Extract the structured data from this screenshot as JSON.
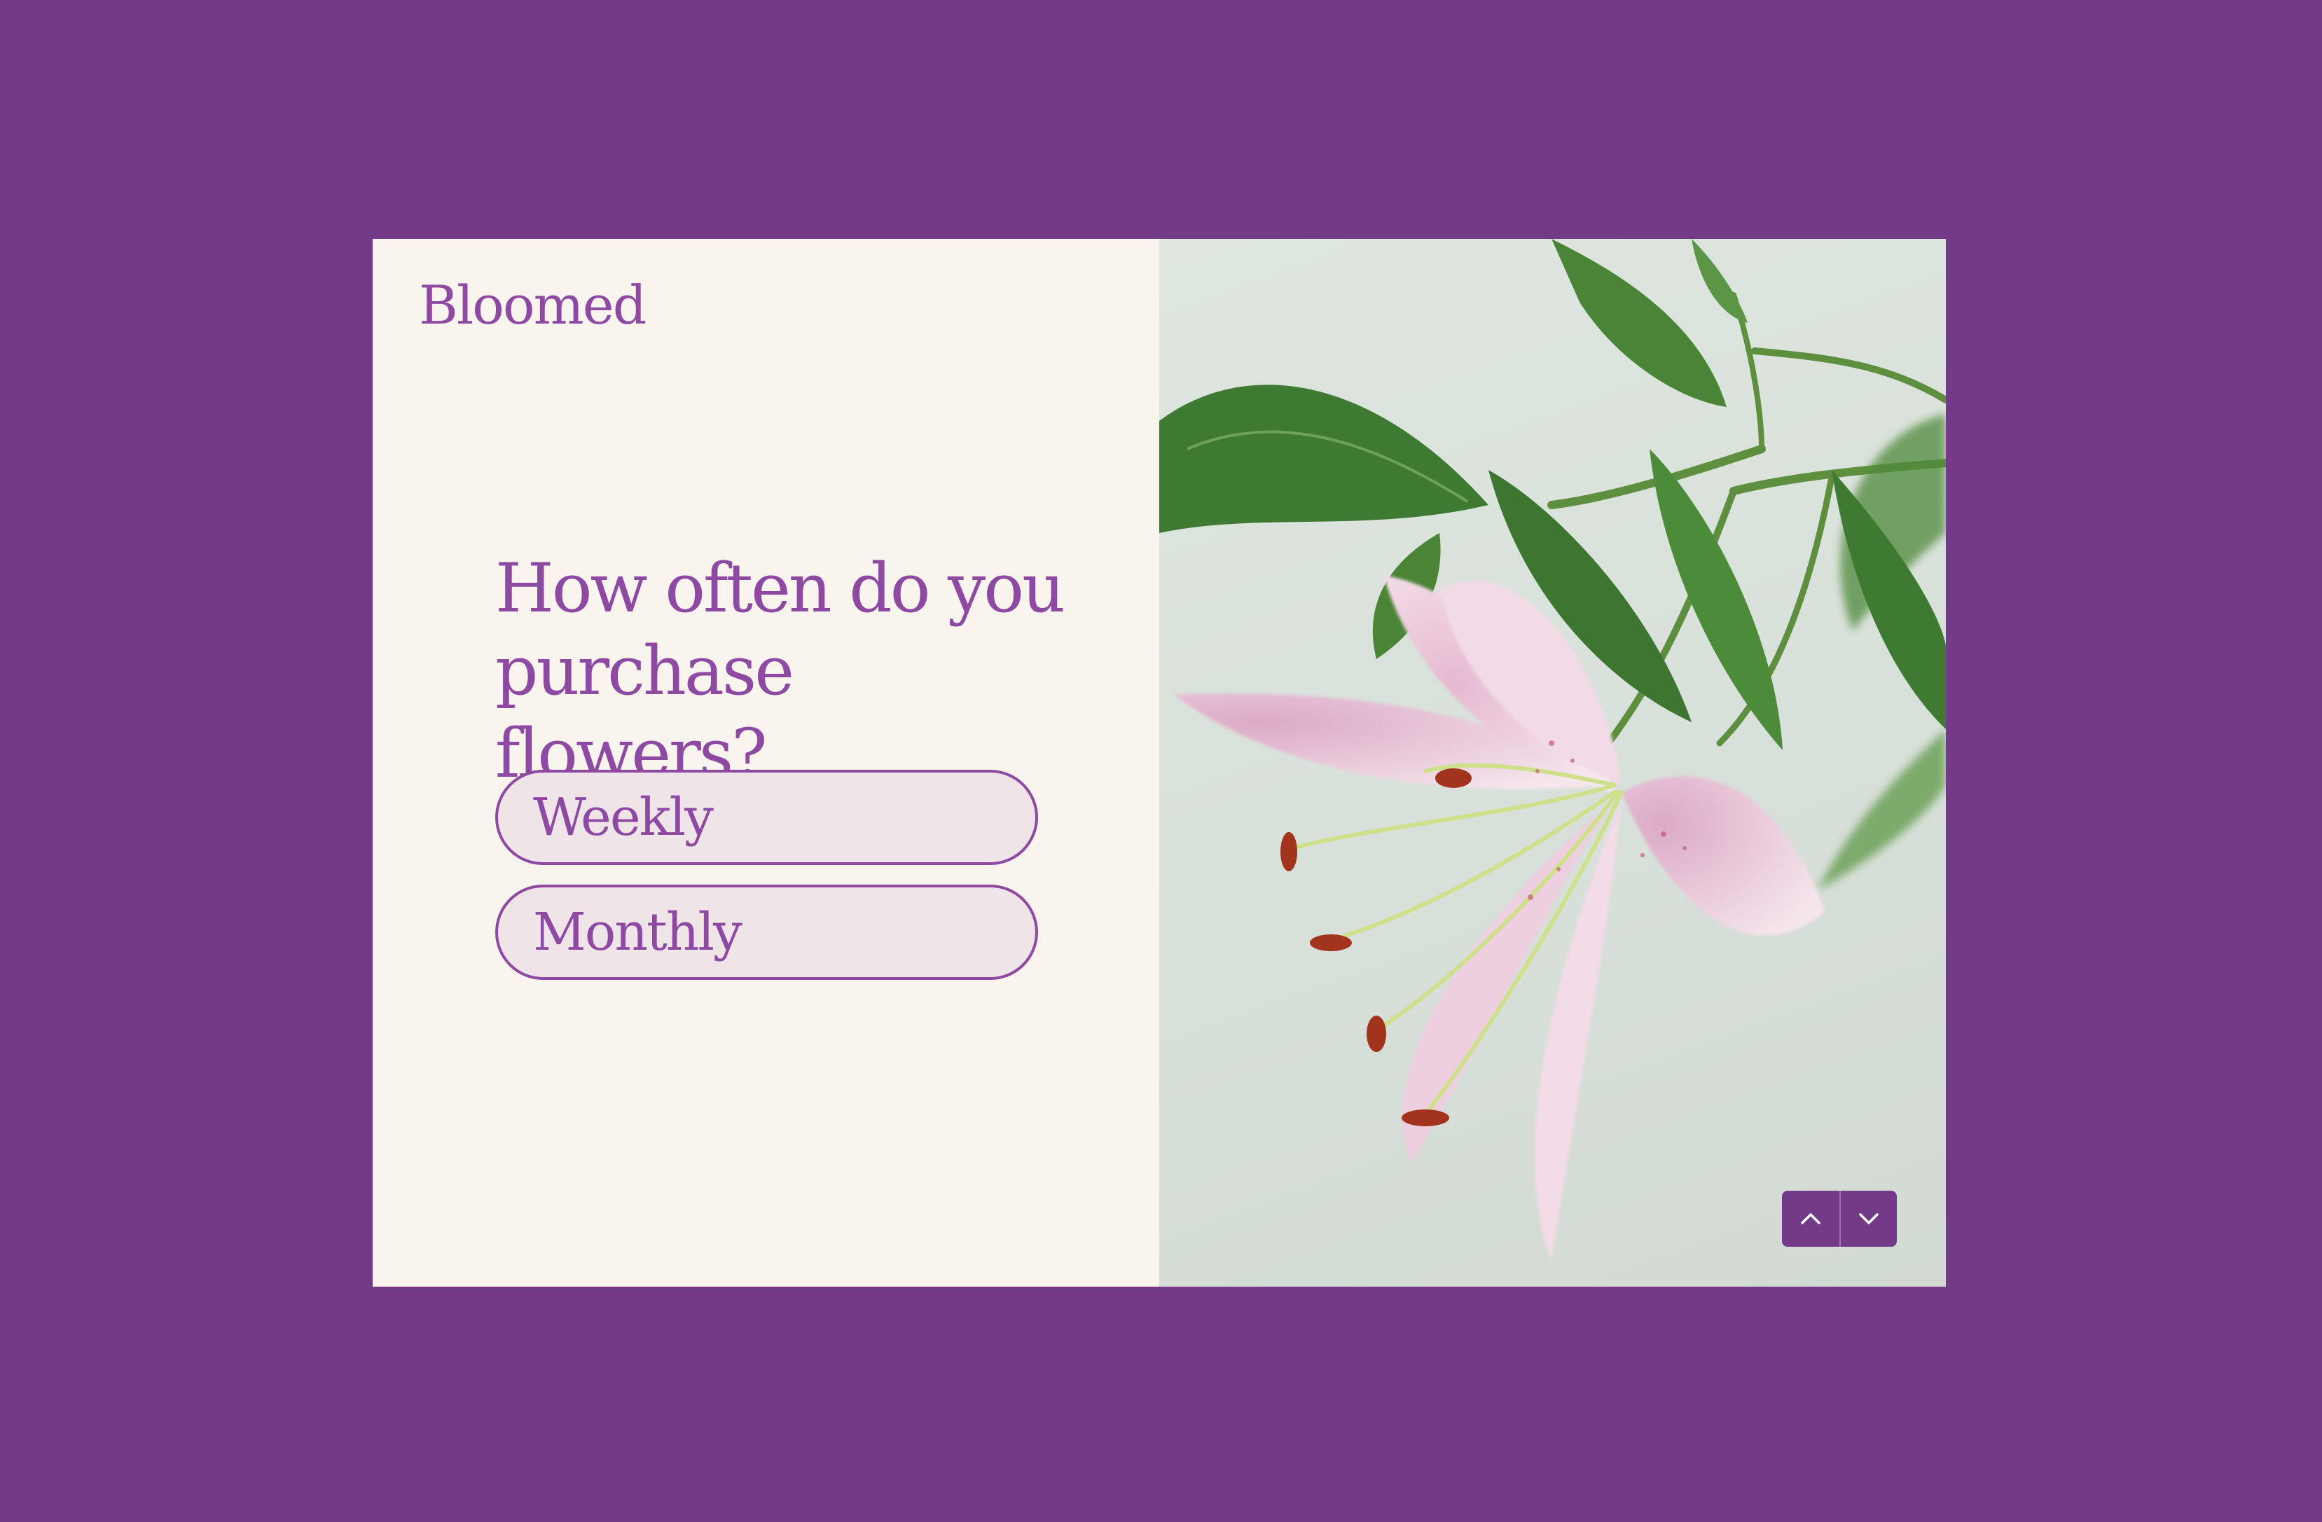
{
  "brand": {
    "name": "Bloomed"
  },
  "question": {
    "text": "How often do you purchase flowers?"
  },
  "options": [
    {
      "label": "Weekly"
    },
    {
      "label": "Monthly"
    }
  ],
  "navigation": {
    "up_icon": "chevron-up-icon",
    "down_icon": "chevron-down-icon"
  },
  "image": {
    "subject": "lily-flower-photo"
  },
  "colors": {
    "background": "#733b87",
    "accent": "#8e4aa3",
    "panel": "#faf4ef",
    "option_fill": "#efe4e7"
  }
}
